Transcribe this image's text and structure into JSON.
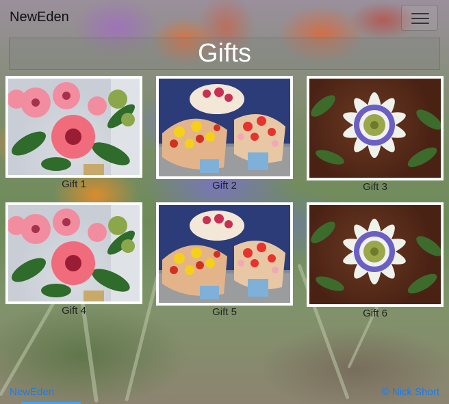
{
  "navbar": {
    "brand": "NewEden",
    "toggle_icon": "hamburger-icon"
  },
  "page": {
    "title": "Gifts"
  },
  "gifts": [
    {
      "caption": "Gift 1",
      "image": "pink-gerbera-bouquet"
    },
    {
      "caption": "Gift 2",
      "image": "mixed-flower-bouquets"
    },
    {
      "caption": "Gift 3",
      "image": "passion-flower"
    },
    {
      "caption": "Gift 4",
      "image": "pink-gerbera-bouquet"
    },
    {
      "caption": "Gift 5",
      "image": "mixed-flower-bouquets"
    },
    {
      "caption": "Gift 6",
      "image": "passion-flower"
    }
  ],
  "footer": {
    "left_link": "NewEden",
    "right_text": "© Nick Short"
  },
  "colors": {
    "link": "#1a7bf0",
    "title_text": "#ffffff"
  }
}
